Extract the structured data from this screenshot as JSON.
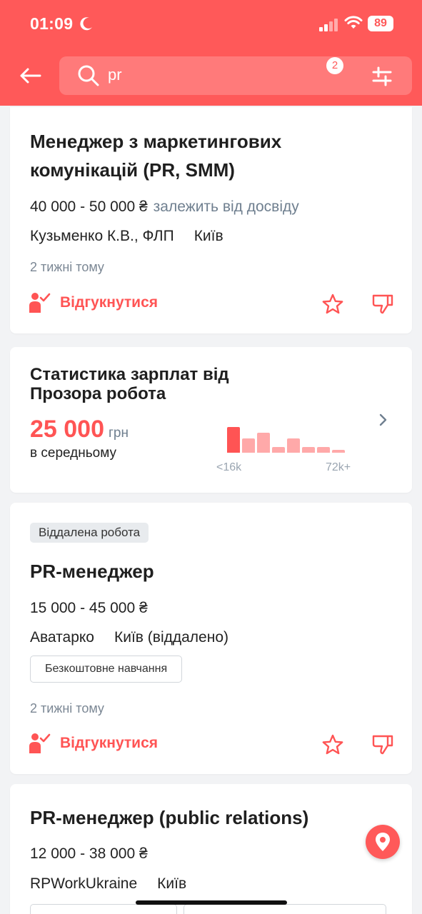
{
  "status_bar": {
    "time": "01:09",
    "battery": "89"
  },
  "search": {
    "query": "pr",
    "filter_count": "2"
  },
  "jobs": [
    {
      "title_line1": "Менеджер з маркетингових",
      "title_line2": "комунікацій (PR, SMM)",
      "salary": "40 000 - 50 000 ₴",
      "salary_note": "залежить від досвіду",
      "company": "Кузьменко К.В., ФЛП",
      "city": "Київ",
      "posted": "2 тижні тому",
      "apply_label": "Відгукнутися"
    },
    {
      "tag": "Віддалена робота",
      "title": "PR-менеджер",
      "salary": "15 000 - 45 000 ₴",
      "company": "Аватарко",
      "city": "Київ (віддалено)",
      "chip": "Безкоштовне навчання",
      "posted": "2 тижні тому",
      "apply_label": "Відгукнутися"
    },
    {
      "title": "PR-менеджер (public relations)",
      "salary": "12 000 - 38 000 ₴",
      "company": "RPWorkUkraine",
      "city": "Київ"
    }
  ],
  "salary_stats": {
    "title_line1": "Статистика зарплат від",
    "title_line2": "Прозора робота",
    "value": "25 000",
    "unit": "грн",
    "subtitle": "в середньому",
    "min_label": "<16k",
    "max_label": "72k+",
    "histogram": [
      1.0,
      0.55,
      0.78,
      0.22,
      0.55,
      0.22,
      0.22,
      0.1
    ],
    "highlight_index": 0
  },
  "colors": {
    "brand": "#ff5959",
    "accent": "#ff5454",
    "bar": "#ff5454",
    "bar_light": "#ffa9a9"
  }
}
